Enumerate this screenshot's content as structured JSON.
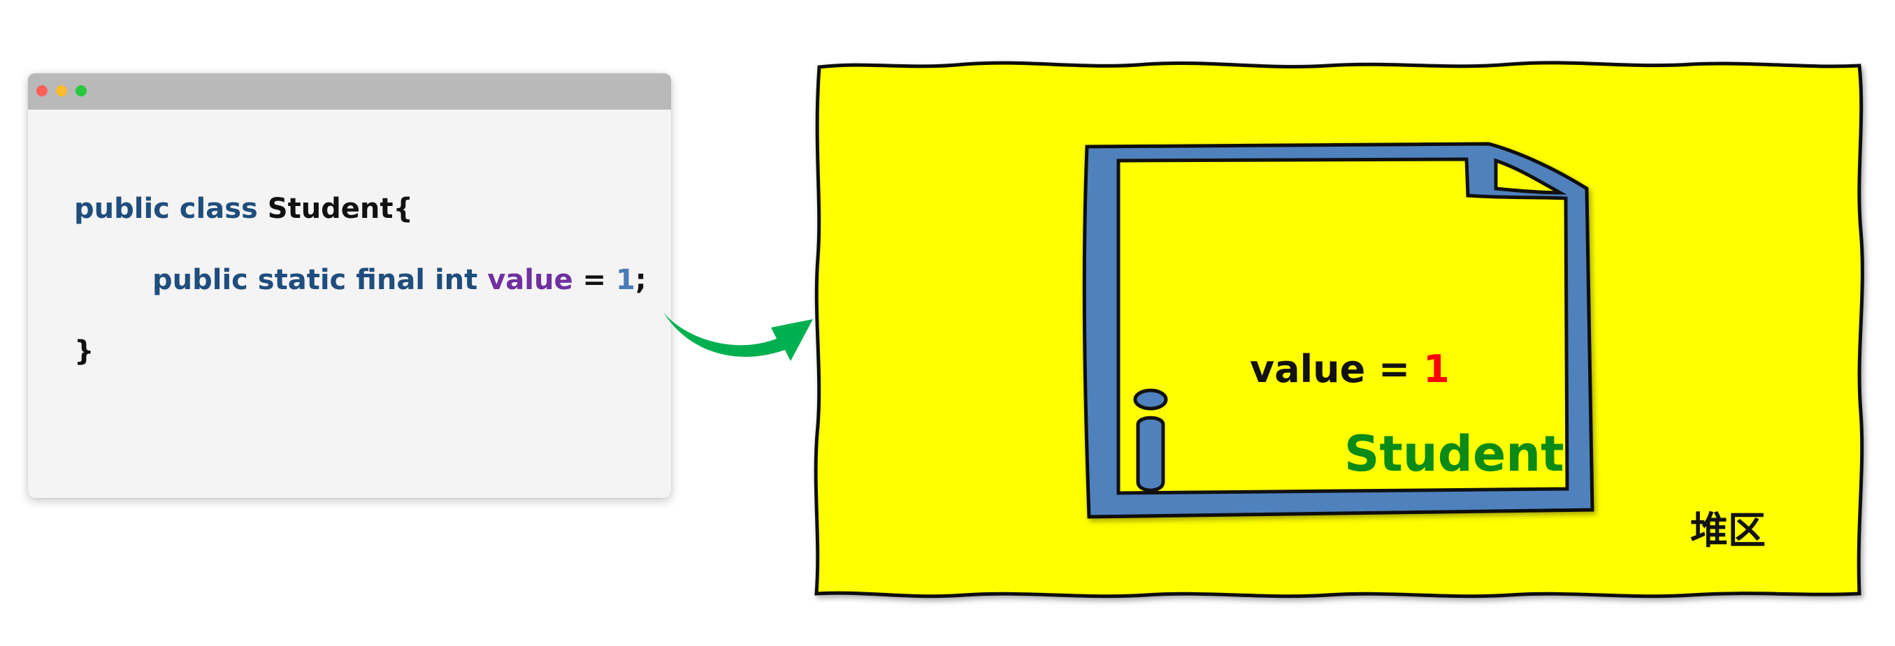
{
  "code": {
    "line1": {
      "kw": "public class ",
      "name": "Student{"
    },
    "line2": {
      "kw": "public static final int ",
      "var": "value",
      "eq": " = ",
      "num": "1",
      "semi": ";"
    },
    "line3": {
      "brace": "}"
    }
  },
  "heap": {
    "label": "堆区",
    "object": {
      "field_name": "value",
      "field_eq": " = ",
      "field_value": "1",
      "class_name": "Student"
    }
  },
  "icons": {
    "window_dots": [
      "close-dot",
      "minimize-dot",
      "maximize-dot"
    ],
    "arrow": "curved-arrow-right",
    "object": "document-icon",
    "info": "info-icon"
  },
  "colors": {
    "keyword": "#1f4e7d",
    "variable": "#7030a0",
    "number": "#4a7ab7",
    "heap_fill": "#ffff00",
    "document_blue": "#4f81bd",
    "arrow_green": "#00b050",
    "class_green": "#0a8a16",
    "value_red": "#ff0000"
  }
}
